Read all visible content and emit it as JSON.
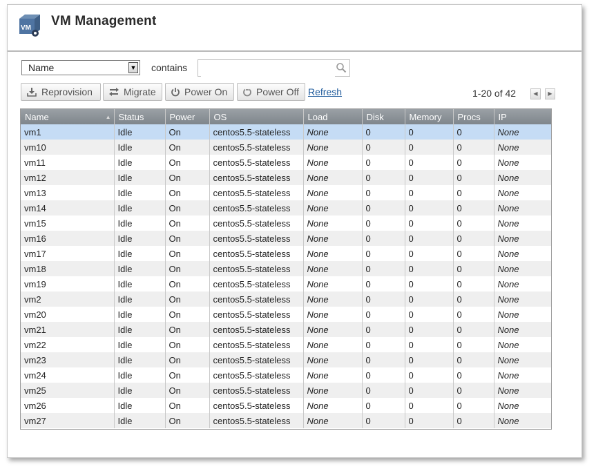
{
  "header": {
    "title": "VM Management",
    "logo_text": "VM"
  },
  "filter": {
    "field_selected": "Name",
    "operator_label": "contains",
    "search_value": "",
    "search_placeholder": ""
  },
  "toolbar": {
    "reprovision_label": "Reprovision",
    "migrate_label": "Migrate",
    "power_on_label": "Power On",
    "power_off_label": "Power Off",
    "refresh_label": "Refresh"
  },
  "pager": {
    "range_text": "1-20 of 42"
  },
  "table": {
    "columns": [
      "Name",
      "Status",
      "Power",
      "OS",
      "Load",
      "Disk",
      "Memory",
      "Procs",
      "IP"
    ],
    "selected_row": 0,
    "rows": [
      [
        "vm1",
        "Idle",
        "On",
        "centos5.5-stateless",
        "None",
        "0",
        "0",
        "0",
        "None"
      ],
      [
        "vm10",
        "Idle",
        "On",
        "centos5.5-stateless",
        "None",
        "0",
        "0",
        "0",
        "None"
      ],
      [
        "vm11",
        "Idle",
        "On",
        "centos5.5-stateless",
        "None",
        "0",
        "0",
        "0",
        "None"
      ],
      [
        "vm12",
        "Idle",
        "On",
        "centos5.5-stateless",
        "None",
        "0",
        "0",
        "0",
        "None"
      ],
      [
        "vm13",
        "Idle",
        "On",
        "centos5.5-stateless",
        "None",
        "0",
        "0",
        "0",
        "None"
      ],
      [
        "vm14",
        "Idle",
        "On",
        "centos5.5-stateless",
        "None",
        "0",
        "0",
        "0",
        "None"
      ],
      [
        "vm15",
        "Idle",
        "On",
        "centos5.5-stateless",
        "None",
        "0",
        "0",
        "0",
        "None"
      ],
      [
        "vm16",
        "Idle",
        "On",
        "centos5.5-stateless",
        "None",
        "0",
        "0",
        "0",
        "None"
      ],
      [
        "vm17",
        "Idle",
        "On",
        "centos5.5-stateless",
        "None",
        "0",
        "0",
        "0",
        "None"
      ],
      [
        "vm18",
        "Idle",
        "On",
        "centos5.5-stateless",
        "None",
        "0",
        "0",
        "0",
        "None"
      ],
      [
        "vm19",
        "Idle",
        "On",
        "centos5.5-stateless",
        "None",
        "0",
        "0",
        "0",
        "None"
      ],
      [
        "vm2",
        "Idle",
        "On",
        "centos5.5-stateless",
        "None",
        "0",
        "0",
        "0",
        "None"
      ],
      [
        "vm20",
        "Idle",
        "On",
        "centos5.5-stateless",
        "None",
        "0",
        "0",
        "0",
        "None"
      ],
      [
        "vm21",
        "Idle",
        "On",
        "centos5.5-stateless",
        "None",
        "0",
        "0",
        "0",
        "None"
      ],
      [
        "vm22",
        "Idle",
        "On",
        "centos5.5-stateless",
        "None",
        "0",
        "0",
        "0",
        "None"
      ],
      [
        "vm23",
        "Idle",
        "On",
        "centos5.5-stateless",
        "None",
        "0",
        "0",
        "0",
        "None"
      ],
      [
        "vm24",
        "Idle",
        "On",
        "centos5.5-stateless",
        "None",
        "0",
        "0",
        "0",
        "None"
      ],
      [
        "vm25",
        "Idle",
        "On",
        "centos5.5-stateless",
        "None",
        "0",
        "0",
        "0",
        "None"
      ],
      [
        "vm26",
        "Idle",
        "On",
        "centos5.5-stateless",
        "None",
        "0",
        "0",
        "0",
        "None"
      ],
      [
        "vm27",
        "Idle",
        "On",
        "centos5.5-stateless",
        "None",
        "0",
        "0",
        "0",
        "None"
      ]
    ]
  },
  "icons": {
    "logo": "vm-gear-icon",
    "dropdown": "chevron-down-icon",
    "search": "search-icon",
    "reprovision": "download-icon",
    "migrate": "migrate-arrows-icon",
    "power_on": "power-icon",
    "power_off": "power-off-icon",
    "prev": "chevron-left-icon",
    "next": "chevron-right-icon",
    "sort": "sort-asc-icon"
  },
  "colors": {
    "header_grad_top": "#9aa0a5",
    "header_grad_bottom": "#7f868c",
    "selected_row": "#c5dcf5",
    "alt_row": "#efefef",
    "link": "#215c9c"
  }
}
